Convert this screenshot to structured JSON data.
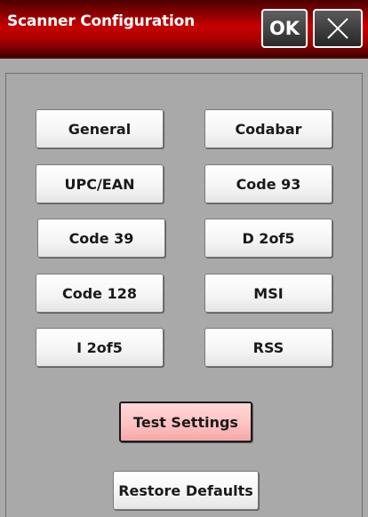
{
  "window": {
    "title": "Scanner Configuration",
    "ok_label": "OK",
    "close_glyph": "close-icon"
  },
  "symbologies": [
    {
      "label": "General"
    },
    {
      "label": "Codabar"
    },
    {
      "label": "UPC/EAN"
    },
    {
      "label": "Code 93"
    },
    {
      "label": "Code 39"
    },
    {
      "label": "D 2of5"
    },
    {
      "label": "Code 128"
    },
    {
      "label": "MSI"
    },
    {
      "label": "I 2of5"
    },
    {
      "label": "RSS"
    }
  ],
  "actions": {
    "test_label": "Test Settings",
    "restore_label": "Restore Defaults"
  },
  "colors": {
    "titlebar": "#c80000",
    "test_button": "#ffc0c0",
    "background": "#a9a9a9"
  }
}
